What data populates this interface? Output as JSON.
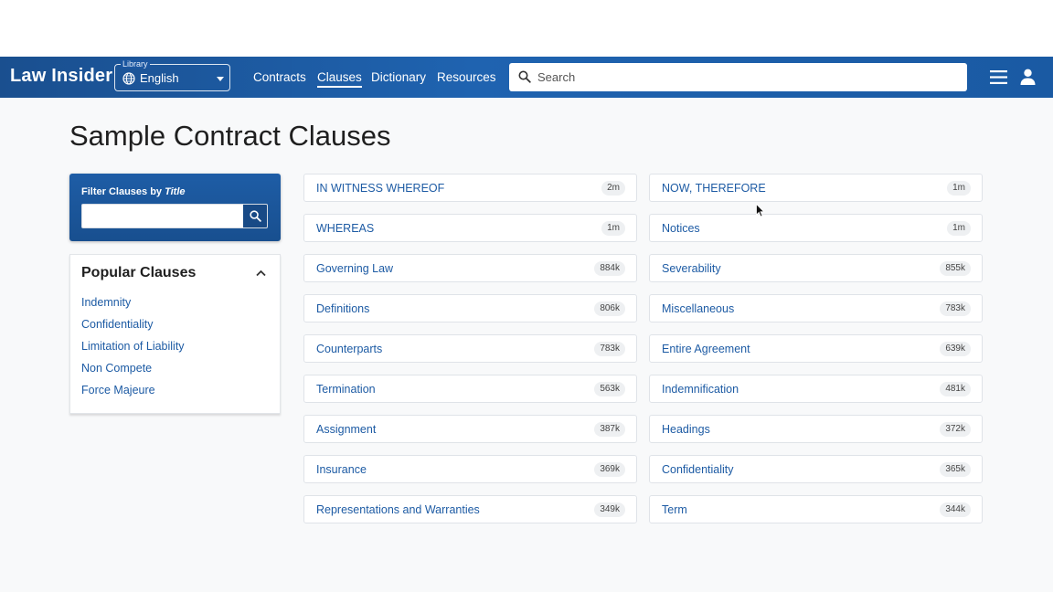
{
  "header": {
    "logo": "Law Insider",
    "library": {
      "label": "Library",
      "value": "English"
    },
    "nav": [
      {
        "label": "Contracts",
        "active": false
      },
      {
        "label": "Clauses",
        "active": true
      },
      {
        "label": "Dictionary",
        "active": false
      },
      {
        "label": "Resources",
        "active": false
      }
    ],
    "search": {
      "placeholder": "Search",
      "value": ""
    }
  },
  "page": {
    "title": "Sample Contract Clauses"
  },
  "filter": {
    "label_prefix": "Filter Clauses by ",
    "label_emphasis": "Title",
    "value": ""
  },
  "popular": {
    "title": "Popular Clauses",
    "items": [
      "Indemnity",
      "Confidentiality",
      "Limitation of Liability",
      "Non Compete",
      "Force Majeure"
    ]
  },
  "clauses": {
    "left": [
      {
        "name": "IN WITNESS WHEREOF",
        "count": "2m"
      },
      {
        "name": "WHEREAS",
        "count": "1m"
      },
      {
        "name": "Governing Law",
        "count": "884k"
      },
      {
        "name": "Definitions",
        "count": "806k"
      },
      {
        "name": "Counterparts",
        "count": "783k"
      },
      {
        "name": "Termination",
        "count": "563k"
      },
      {
        "name": "Assignment",
        "count": "387k"
      },
      {
        "name": "Insurance",
        "count": "369k"
      },
      {
        "name": "Representations and Warranties",
        "count": "349k"
      }
    ],
    "right": [
      {
        "name": "NOW, THEREFORE",
        "count": "1m"
      },
      {
        "name": "Notices",
        "count": "1m"
      },
      {
        "name": "Severability",
        "count": "855k"
      },
      {
        "name": "Miscellaneous",
        "count": "783k"
      },
      {
        "name": "Entire Agreement",
        "count": "639k"
      },
      {
        "name": "Indemnification",
        "count": "481k"
      },
      {
        "name": "Headings",
        "count": "372k"
      },
      {
        "name": "Confidentiality",
        "count": "365k"
      },
      {
        "name": "Term",
        "count": "344k"
      }
    ]
  },
  "colors": {
    "nav_bg": "#1f63b0",
    "link": "#1d5ba4",
    "filter_bg": "#1e5da6",
    "page_bg": "#f8f9fa"
  }
}
